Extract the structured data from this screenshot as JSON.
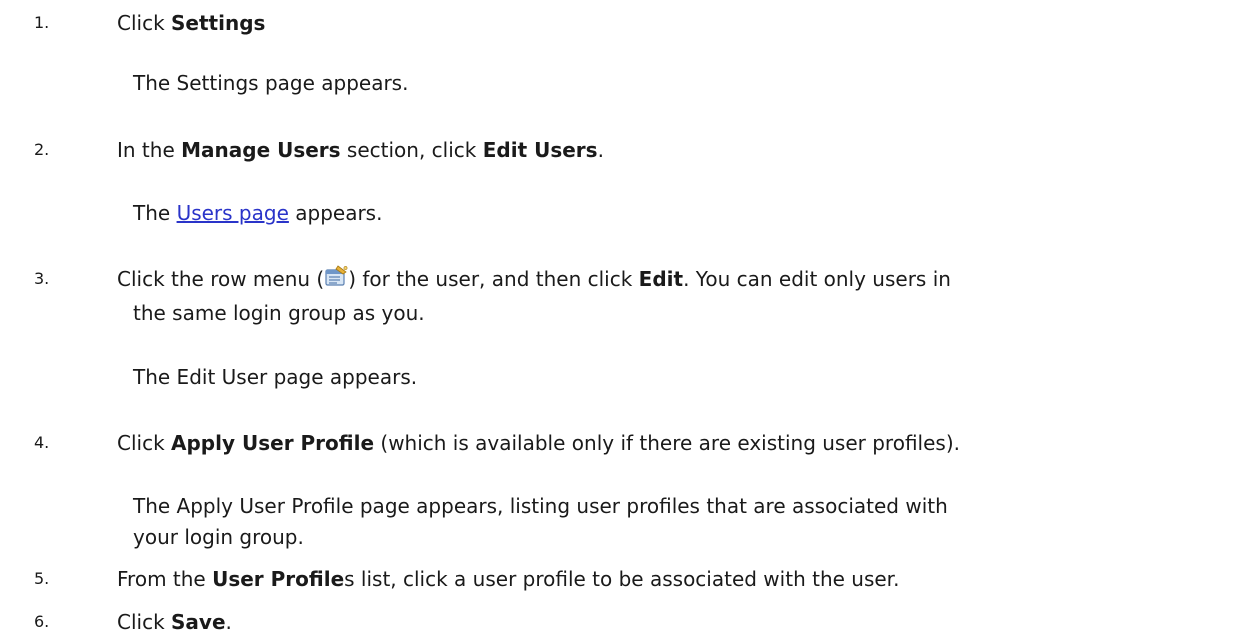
{
  "steps": [
    {
      "number": "1.",
      "pre": "Click ",
      "bold": "Settings",
      "result": "The Settings page appears."
    },
    {
      "number": "2.",
      "pre": "In the ",
      "bold1": "Manage Users",
      "mid": " section, click ",
      "bold2": "Edit Users",
      "post": ".",
      "result_pre": "The ",
      "result_link": "Users page",
      "result_post": " appears."
    },
    {
      "number": "3.",
      "pre": "Click the row menu (",
      "icon": "row-menu-icon",
      "mid": ") for the user, and then click ",
      "bold": "Edit",
      "post": ". You can edit only users in",
      "cont": "the same login group as you.",
      "result": "The Edit User page appears."
    },
    {
      "number": "4.",
      "pre": "Click ",
      "bold": "Apply User Profile",
      "post": " (which is available only if there are existing user profiles).",
      "result_line1": "The Apply User Profile page appears, listing user profiles that are associated with",
      "result_line2": "your login group."
    },
    {
      "number": "5.",
      "pre": "From the ",
      "bold": "User Profile",
      "post": "s list, click a user profile to be associated with the user."
    },
    {
      "number": "6.",
      "pre": "Click ",
      "bold": "Save",
      "post": "."
    }
  ],
  "colors": {
    "text": "#1a1a1a",
    "link": "#2a34c9"
  }
}
